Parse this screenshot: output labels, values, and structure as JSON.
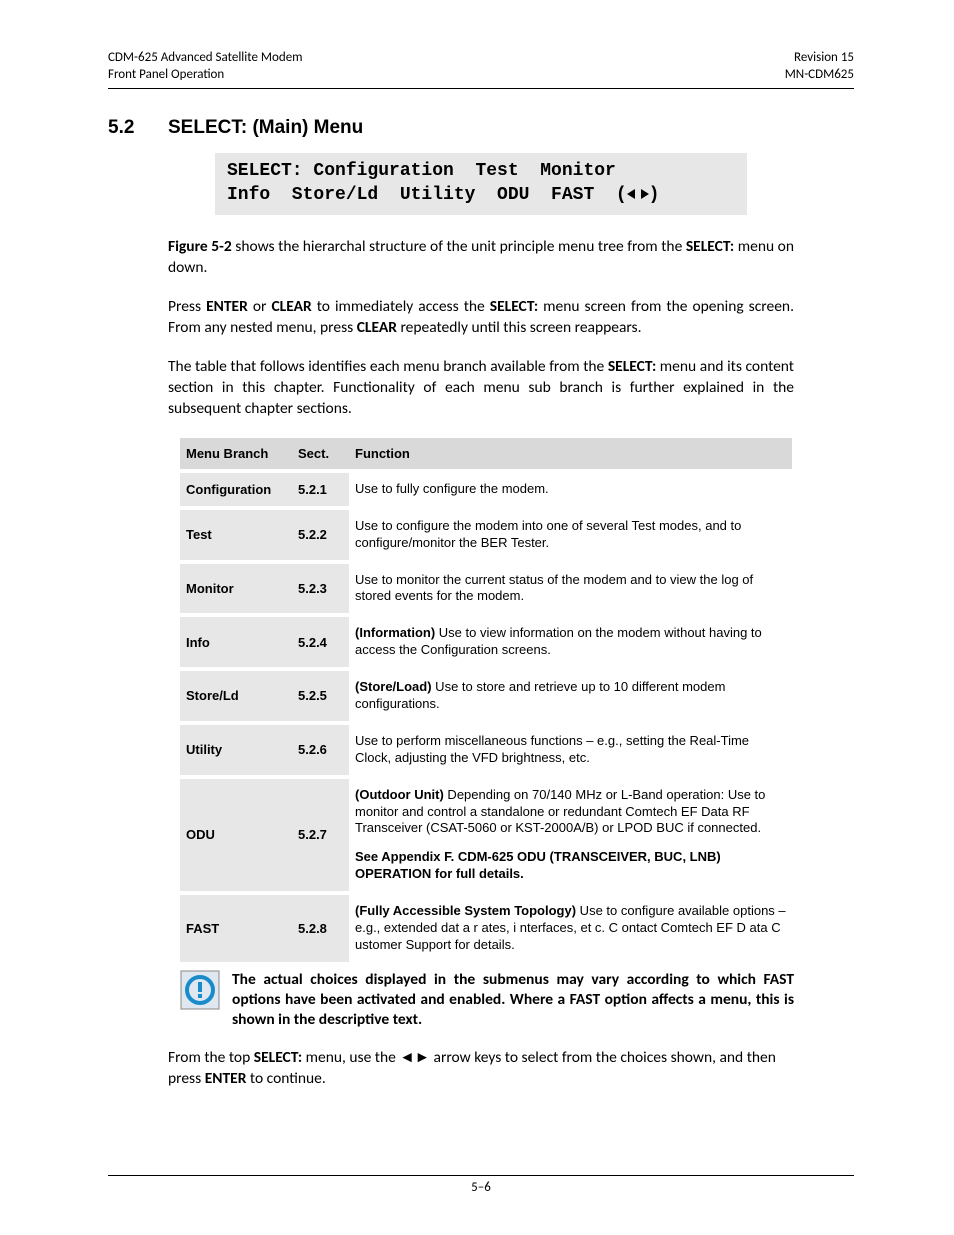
{
  "header": {
    "left_line1": "CDM-625 Advanced Satellite Modem",
    "left_line2": "Front Panel Operation",
    "right_line1": "Revision 15",
    "right_line2": "MN-CDM625"
  },
  "heading": {
    "number": "5.2",
    "title": "SELECT: (Main) Menu"
  },
  "lcd": {
    "line1": "SELECT: Configuration  Test  Monitor",
    "line2_pre": "Info  Store/Ld  Utility  ODU  FAST  (",
    "line2_post": ")"
  },
  "para1_pre": "Figure 5-2",
  "para1_rest": " shows the hierarchal structure of the unit principle menu tree from the ",
  "para1_bold2": "SELECT:",
  "para1_end": " menu on down.",
  "para2_a": "Press ",
  "para2_b1": "ENTER",
  "para2_b": " or ",
  "para2_b2": "CLEAR",
  "para2_c": " to immediately access the ",
  "para2_b3": "SELECT:",
  "para2_d": " menu screen from the opening screen. From any nested menu, press ",
  "para2_b4": "CLEAR",
  "para2_e": " repeatedly until this screen reappears.",
  "para3_a": "The table that follows identifies each menu branch available from the ",
  "para3_b1": "SELECT:",
  "para3_b": " menu and its content section in this chapter. Functionality of each menu sub branch is further explained in the subsequent chapter sections.",
  "table": {
    "headers": {
      "c1": "Menu Branch",
      "c2": "Sect.",
      "c3": "Function"
    },
    "rows": [
      {
        "branch": "Configuration",
        "sect": "5.2.1",
        "func": "Use to fully configure the modem."
      },
      {
        "branch": "Test",
        "sect": "5.2.2",
        "func": "Use to configure the modem into one of several Test modes, and to configure/monitor the BER Tester."
      },
      {
        "branch": "Monitor",
        "sect": "5.2.3",
        "func": "Use to monitor the current status of the modem and to view the log of stored events for the modem."
      },
      {
        "branch": "Info",
        "sect": "5.2.4",
        "func_bold": "(Information)",
        "func": " Use to view information on the modem without having to access the Configuration screens."
      },
      {
        "branch": "Store/Ld",
        "sect": "5.2.5",
        "func_bold": "(Store/Load)",
        "func": " Use to store and retrieve up to 10 different modem configurations."
      },
      {
        "branch": "Utility",
        "sect": "5.2.6",
        "func": "Use to perform miscellaneous functions – e.g., setting the Real-Time Clock, adjusting the VFD brightness, etc."
      },
      {
        "branch": "ODU",
        "sect": "5.2.7",
        "func_bold": "(Outdoor Unit)",
        "func": " Depending on 70/140 MHz or L-Band operation: Use to monitor and control a standalone or redundant Comtech EF Data RF Transceiver (CSAT-5060 or KST-2000A/B) or LPOD BUC if connected.",
        "func_extra_bold": "See Appendix F. CDM-625 ODU (TRANSCEIVER, BUC, LNB) OPERATION for full details."
      },
      {
        "branch": "FAST",
        "sect": "5.2.8",
        "func_bold": "(Fully Accessible System Topology)",
        "func": " Use to configure available options – e.g., extended dat a r ates, i nterfaces, et c. C ontact  Comtech  EF D ata C ustomer Support for details."
      }
    ]
  },
  "note": "The actual choices displayed in the submenus may vary according to which FAST options have been activated and enabled. Where a FAST option affects a menu, this is shown in the descriptive text.",
  "para4_a": "From the top ",
  "para4_b1": "SELECT:",
  "para4_b": " menu, use the ◄► arrow keys to select from the choices shown, and then press ",
  "para4_b2": "ENTER",
  "para4_c": " to continue.",
  "footer": {
    "page": "5–6"
  }
}
